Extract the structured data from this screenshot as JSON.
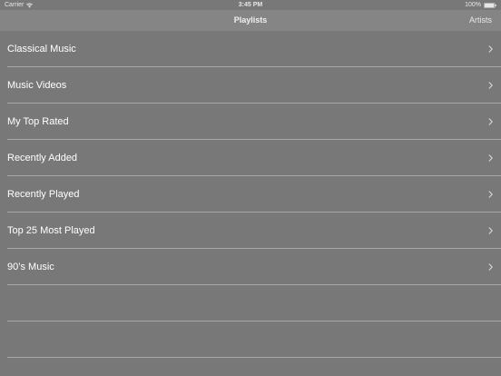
{
  "status_bar": {
    "carrier": "Carrier",
    "time": "3:45 PM",
    "battery": "100%",
    "wifi_icon": "wifi-icon",
    "battery_icon": "battery-icon"
  },
  "nav_bar": {
    "title": "Playlists",
    "right_button": "Artists"
  },
  "playlists": [
    {
      "label": "Classical Music"
    },
    {
      "label": "Music Videos"
    },
    {
      "label": "My Top Rated"
    },
    {
      "label": "Recently Added"
    },
    {
      "label": "Recently Played"
    },
    {
      "label": "Top 25 Most Played"
    },
    {
      "label": "90’s Music"
    },
    {
      "label": ""
    },
    {
      "label": ""
    }
  ],
  "colors": {
    "background": "#787878",
    "nav_bar": "#858585",
    "separator": "#a8a8a8",
    "text": "#ffffff"
  }
}
